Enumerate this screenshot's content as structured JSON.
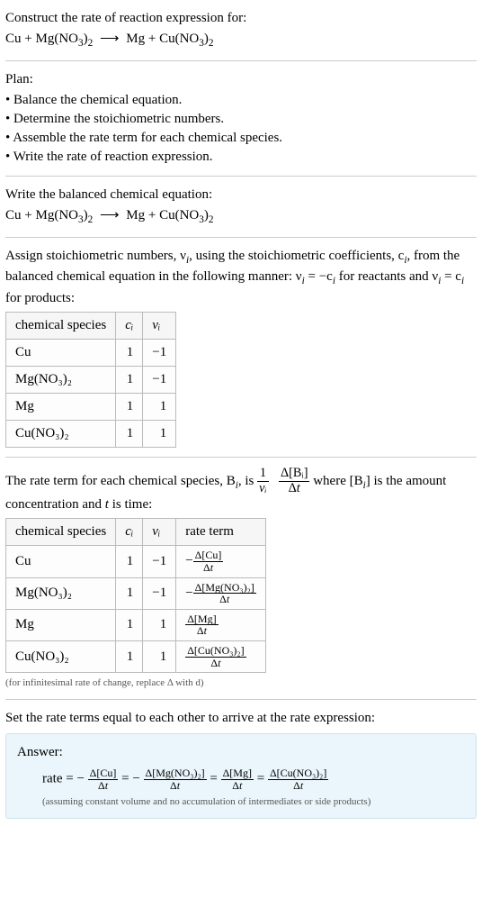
{
  "intro": {
    "prompt": "Construct the rate of reaction expression for:",
    "equation_lhs1": "Cu",
    "equation_lhs2": "Mg(NO",
    "equation_lhs2_sub1": "3",
    "equation_lhs2_paren": ")",
    "equation_lhs2_sub2": "2",
    "arrow": "⟶",
    "equation_rhs1": "Mg",
    "equation_rhs2": "Cu(NO",
    "equation_rhs2_sub1": "3",
    "equation_rhs2_paren": ")",
    "equation_rhs2_sub2": "2"
  },
  "plan": {
    "title": "Plan:",
    "items": [
      "Balance the chemical equation.",
      "Determine the stoichiometric numbers.",
      "Assemble the rate term for each chemical species.",
      "Write the rate of reaction expression."
    ]
  },
  "balanced": {
    "title": "Write the balanced chemical equation:"
  },
  "assign": {
    "text1": "Assign stoichiometric numbers, ν",
    "text1_sub": "i",
    "text2": ", using the stoichiometric coefficients, c",
    "text2_sub": "i",
    "text3": ", from the balanced chemical equation in the following manner: ν",
    "text3_sub": "i",
    "text4": " = −c",
    "text4_sub": "i",
    "text5": " for reactants and ν",
    "text5_sub": "i",
    "text6": " = c",
    "text6_sub": "i",
    "text7": " for products:"
  },
  "table1": {
    "h1": "chemical species",
    "h2": "cᵢ",
    "h3": "νᵢ",
    "rows": [
      {
        "sp": "Cu",
        "c": "1",
        "v": "−1"
      },
      {
        "sp": "Mg(NO₃)₂",
        "c": "1",
        "v": "−1"
      },
      {
        "sp": "Mg",
        "c": "1",
        "v": "1"
      },
      {
        "sp": "Cu(NO₃)₂",
        "c": "1",
        "v": "1"
      }
    ]
  },
  "rateterm": {
    "t1": "The rate term for each chemical species, B",
    "t1_sub": "i",
    "t2": ", is ",
    "frac1_num": "1",
    "frac1_den": "νᵢ",
    "frac2_num": "Δ[Bᵢ]",
    "frac2_den": "Δt",
    "t3": " where [B",
    "t3_sub": "i",
    "t4": "] is the amount concentration and ",
    "t_var": "t",
    "t5": " is time:"
  },
  "table2": {
    "h1": "chemical species",
    "h2": "cᵢ",
    "h3": "νᵢ",
    "h4": "rate term",
    "rows": [
      {
        "sp": "Cu",
        "c": "1",
        "v": "−1",
        "rt_sign": "−",
        "rt_num": "Δ[Cu]",
        "rt_den": "Δt"
      },
      {
        "sp": "Mg(NO₃)₂",
        "c": "1",
        "v": "−1",
        "rt_sign": "−",
        "rt_num": "Δ[Mg(NO₃)₂]",
        "rt_den": "Δt"
      },
      {
        "sp": "Mg",
        "c": "1",
        "v": "1",
        "rt_sign": "",
        "rt_num": "Δ[Mg]",
        "rt_den": "Δt"
      },
      {
        "sp": "Cu(NO₃)₂",
        "c": "1",
        "v": "1",
        "rt_sign": "",
        "rt_num": "Δ[Cu(NO₃)₂]",
        "rt_den": "Δt"
      }
    ],
    "note": "(for infinitesimal rate of change, replace Δ with d)"
  },
  "final": {
    "title": "Set the rate terms equal to each other to arrive at the rate expression:"
  },
  "answer": {
    "label": "Answer:",
    "rate": "rate = −",
    "f1_num": "Δ[Cu]",
    "f1_den": "Δt",
    "eq1": " = −",
    "f2_num": "Δ[Mg(NO₃)₂]",
    "f2_den": "Δt",
    "eq2": " = ",
    "f3_num": "Δ[Mg]",
    "f3_den": "Δt",
    "eq3": " = ",
    "f4_num": "Δ[Cu(NO₃)₂]",
    "f4_den": "Δt",
    "assume": "(assuming constant volume and no accumulation of intermediates or side products)"
  }
}
